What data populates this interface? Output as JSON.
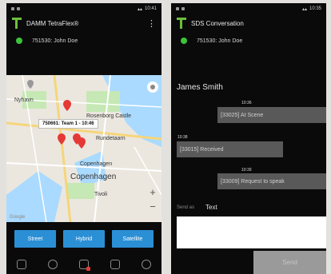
{
  "phone1": {
    "status_time": "10:41",
    "app_title": "DAMM TetraFlex®",
    "user_line": "751530: John Doe",
    "map": {
      "callout": "750661: Team 1 - 10:46",
      "labels": [
        "Nyhavn",
        "Rosenborg Castle",
        "Rundetaarn",
        "Copenhagen",
        "Copenhagen",
        "Tivoli",
        "Google"
      ]
    },
    "map_types": [
      "Street",
      "Hybrid",
      "Satellite"
    ],
    "nav_icons": [
      "shield-icon",
      "call-icon",
      "group-call-icon",
      "message-icon",
      "globe-icon"
    ]
  },
  "phone2": {
    "status_time": "10:35",
    "app_title": "SDS Conversation",
    "user_line": "751530: John Doe",
    "contact_name": "James Smith",
    "messages": [
      {
        "time": "10:36",
        "text": "[33025] At Scene"
      },
      {
        "time": "10:38",
        "text": "[33015] Received"
      },
      {
        "time": "10:39",
        "text": "[33009] Request to speak"
      }
    ],
    "send_as_label": "Send as",
    "send_as_value": "Text",
    "send_label": "Send"
  },
  "colors": {
    "accent_green": "#6cbf3c",
    "online": "#3cc43c",
    "button_blue": "#2b8fd6",
    "bubble": "#595959"
  }
}
